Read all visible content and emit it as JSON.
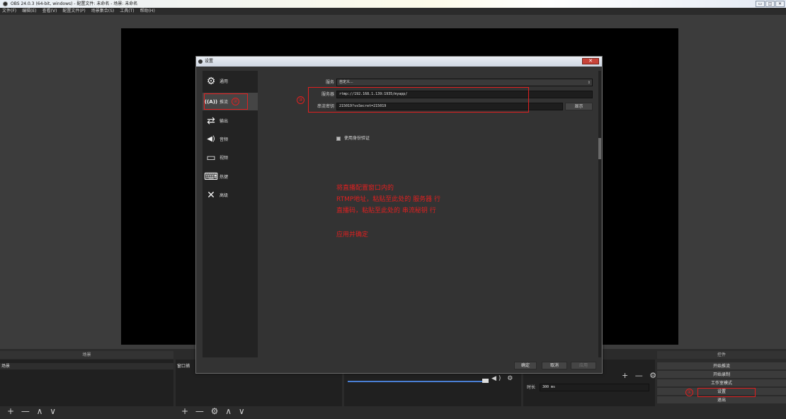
{
  "window": {
    "title": "OBS 24.0.3 (64-bit, windows) - 配置文件: 未命名 - 场景: 未命名",
    "controls": [
      "▭",
      "◫",
      "✕"
    ]
  },
  "menu": [
    "文件(F)",
    "编辑(E)",
    "查看(V)",
    "配置文件(P)",
    "场景集合(S)",
    "工具(T)",
    "帮助(H)"
  ],
  "docks": {
    "scenes_header": "场景",
    "scene_item": "场景",
    "sources_item": "窗口捕",
    "controls_header": "控件",
    "buttons": [
      "开始推流",
      "开始录制",
      "工作室模式",
      "设置",
      "退出"
    ],
    "duration_label": "时长",
    "duration_value": "300 ms",
    "scene_tools": "+ — ∧ ∨",
    "source_tools": "+ — ⚙ ∧ ∨",
    "mixer_tools": "◀) ⚙",
    "transition_tools": "+ — ⚙"
  },
  "dialog": {
    "title": "设置",
    "sidebar": [
      {
        "label": "通用",
        "icon": "gear-icon",
        "glyph": "⚙"
      },
      {
        "label": "推流",
        "icon": "broadcast-icon",
        "glyph": "((A))"
      },
      {
        "label": "输出",
        "icon": "output-icon",
        "glyph": "⇄"
      },
      {
        "label": "音频",
        "icon": "speaker-icon",
        "glyph": "◀)"
      },
      {
        "label": "视频",
        "icon": "monitor-icon",
        "glyph": "▭"
      },
      {
        "label": "热键",
        "icon": "keyboard-icon",
        "glyph": "⌨"
      },
      {
        "label": "高级",
        "icon": "tools-icon",
        "glyph": "✕"
      }
    ],
    "service_label": "服务",
    "service_value": "自定义...",
    "server_label": "服务器",
    "server_value": "rtmp://192.168.1.139:1935/myapp/",
    "key_label": "串流密钥",
    "key_value": "215019?vsSecret=215019",
    "show_button": "显示",
    "auth_label": "使用身份验证",
    "ok_button": "确定",
    "cancel_button": "取消",
    "apply_button": "应用"
  },
  "annotations": {
    "line1": "将直播配置窗口内的",
    "line2": "RTMP地址，粘贴至此处的 服务器 行",
    "line3": "直播码，粘贴至此处的 串流秘钥 行",
    "line4": "应用并确定",
    "mark1": "①",
    "mark2": "②",
    "mark3": "③"
  },
  "colors": {
    "annotation_red": "#e02020",
    "panel_bg": "#333333",
    "preview_bg": "#000000"
  }
}
